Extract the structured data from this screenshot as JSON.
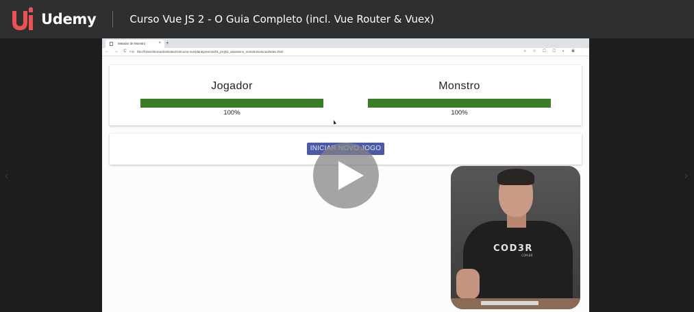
{
  "header": {
    "brand": "Udemy",
    "course_title": "Curso Vue JS 2 - O Guia Completo (incl. Vue Router & Vuex)"
  },
  "browser": {
    "tab_title": "Matador de Monstro",
    "url_prefix": "File",
    "url": "file:///Users/leonardomleitao/Git/curso-vue/planejamento/04_proj01_assassino_monstro/solucao/index.html"
  },
  "game": {
    "player": {
      "label": "Jogador",
      "health_label": "100%",
      "health_fraction": 1.0
    },
    "monster": {
      "label": "Monstro",
      "health_label": "100%",
      "health_fraction": 1.0
    },
    "new_game_button": "INICIAR NOVO JOGO"
  },
  "webcam": {
    "shirt_logo": "COD3R",
    "shirt_sub": ".COM.BR"
  },
  "colors": {
    "health_bar": "#3a7d27",
    "button": "#4b5aa8",
    "header_bg": "#2d2f31",
    "udemy_brand": "#ec5252"
  },
  "icons": {
    "play": "play-icon",
    "prev": "chevron-left-icon",
    "next": "chevron-right-icon"
  }
}
